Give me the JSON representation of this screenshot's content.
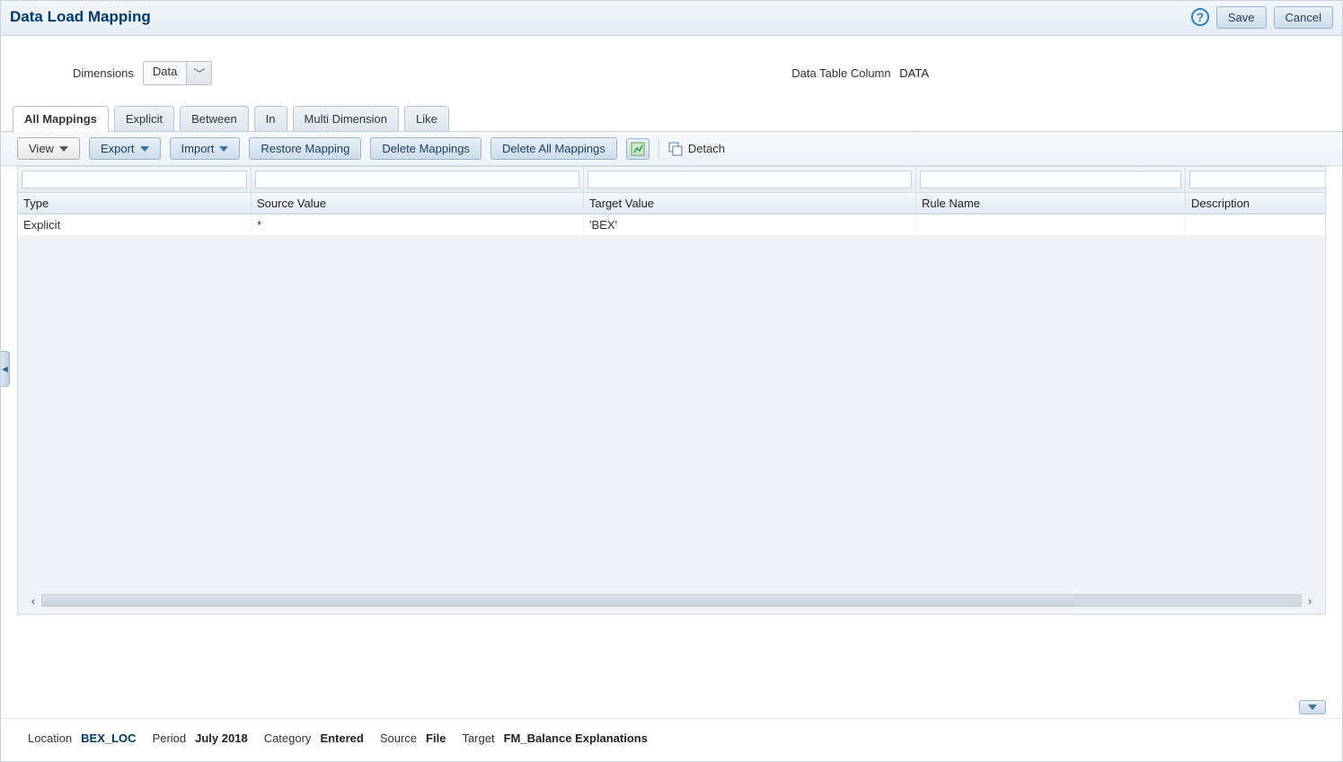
{
  "header": {
    "title": "Data Load Mapping",
    "save": "Save",
    "cancel": "Cancel"
  },
  "form": {
    "dimensions_label": "Dimensions",
    "dimensions_value": "Data",
    "data_table_label": "Data Table Column",
    "data_table_value": "DATA"
  },
  "tabs": [
    {
      "label": "All Mappings",
      "active": true
    },
    {
      "label": "Explicit",
      "active": false
    },
    {
      "label": "Between",
      "active": false
    },
    {
      "label": "In",
      "active": false
    },
    {
      "label": "Multi Dimension",
      "active": false
    },
    {
      "label": "Like",
      "active": false
    }
  ],
  "toolbar": {
    "view": "View",
    "export": "Export",
    "import": "Import",
    "restore": "Restore Mapping",
    "delete_mappings": "Delete Mappings",
    "delete_all": "Delete All Mappings",
    "detach": "Detach"
  },
  "table": {
    "columns": [
      "Type",
      "Source Value",
      "Target Value",
      "Rule Name",
      "Description"
    ],
    "rows": [
      {
        "type": "Explicit",
        "source": "*",
        "target": "'BEX'",
        "rule": "",
        "description": ""
      }
    ]
  },
  "status": {
    "location_lbl": "Location",
    "location_val": "BEX_LOC",
    "period_lbl": "Period",
    "period_val": "July 2018",
    "category_lbl": "Category",
    "category_val": "Entered",
    "source_lbl": "Source",
    "source_val": "File",
    "target_lbl": "Target",
    "target_val": "FM_Balance Explanations"
  }
}
